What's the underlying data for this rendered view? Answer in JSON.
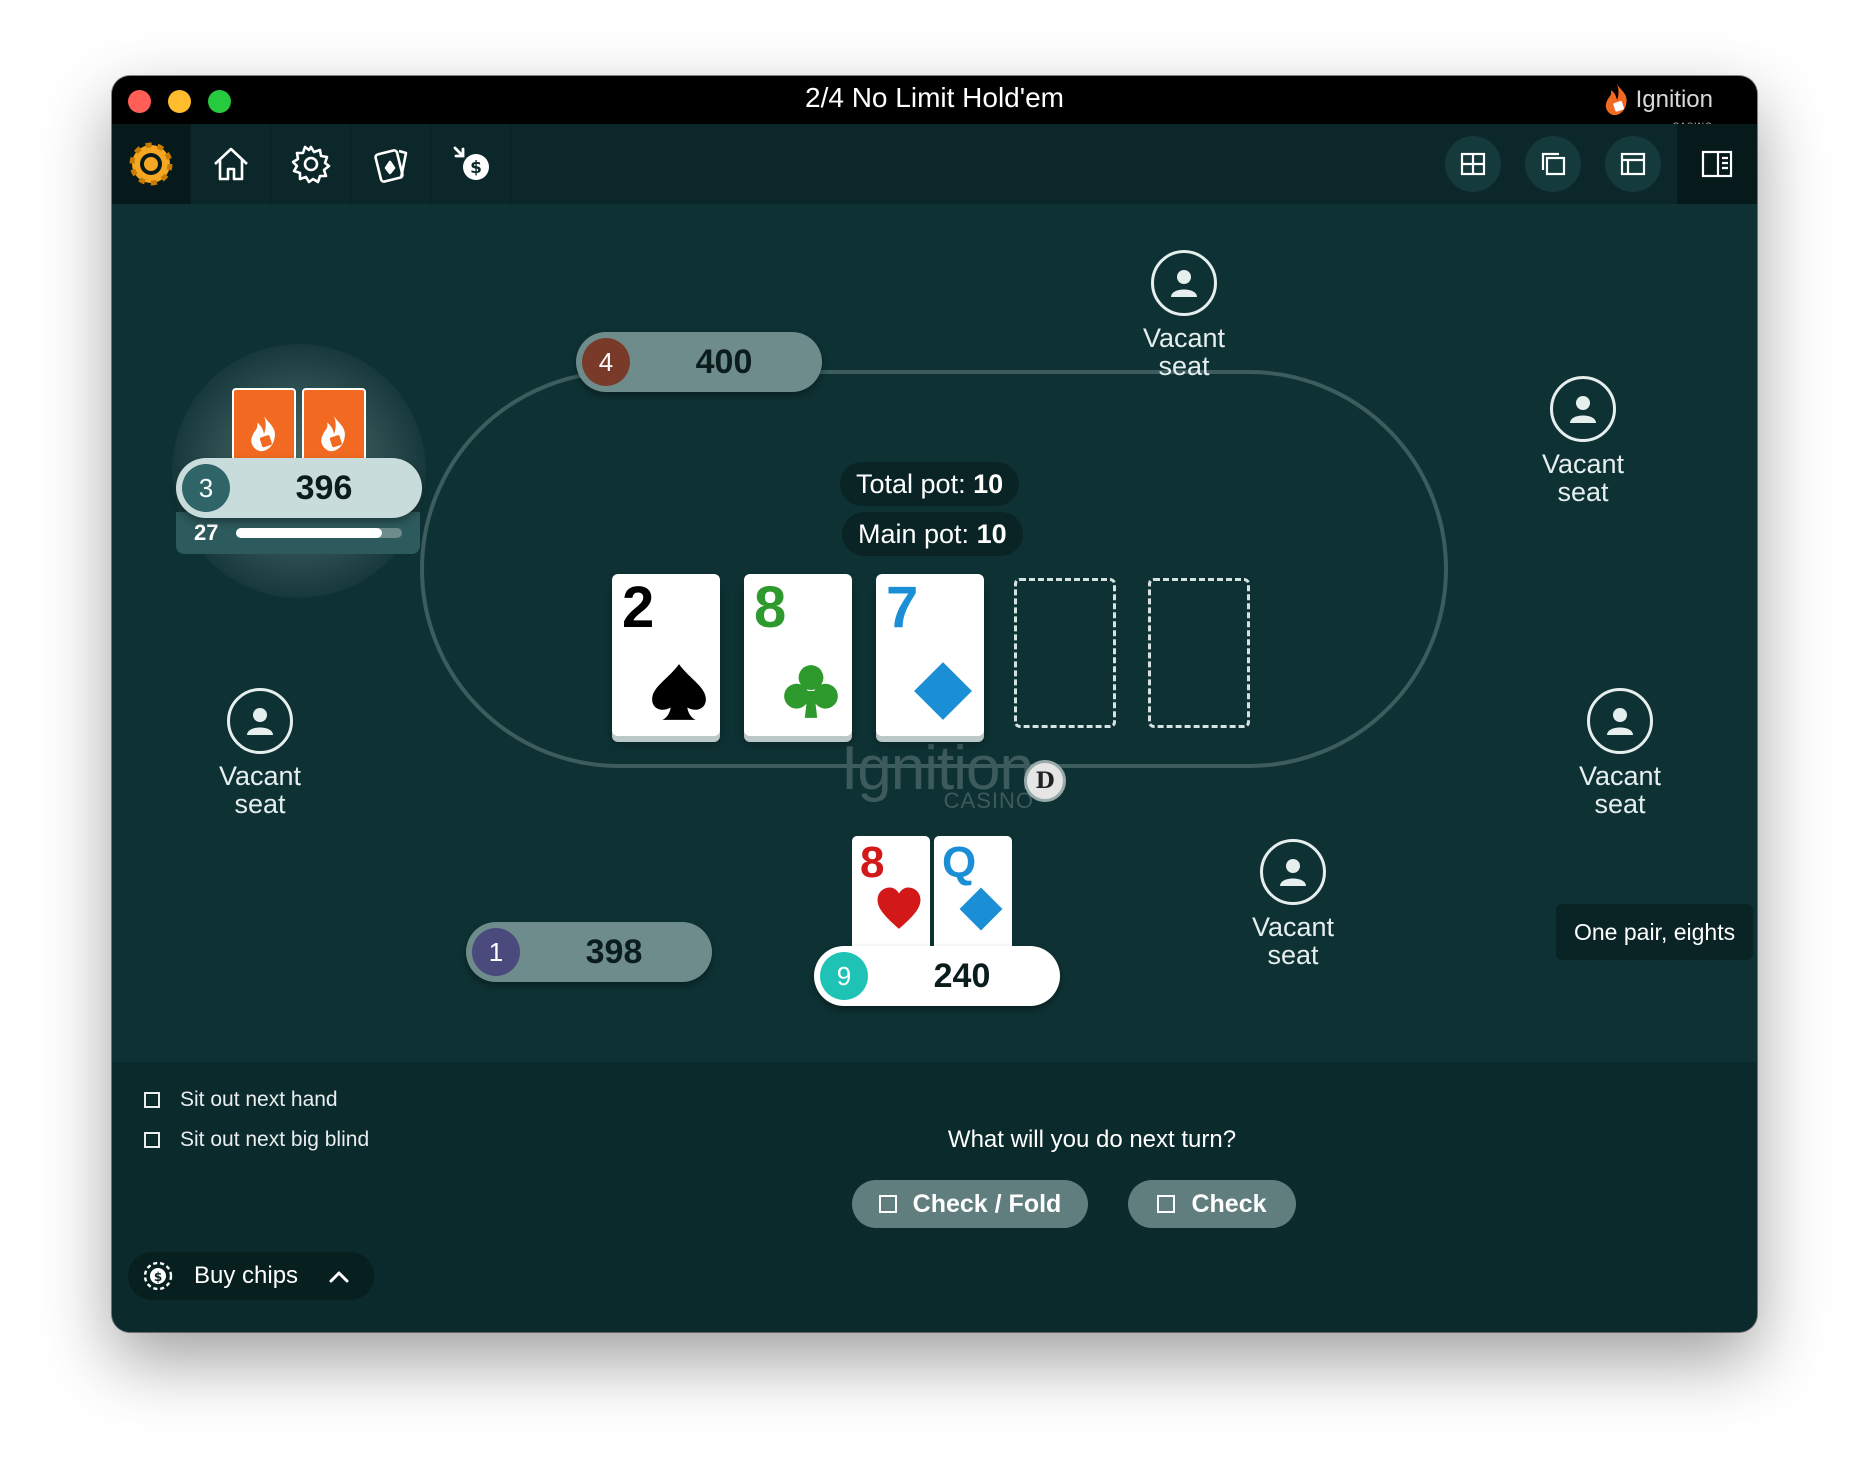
{
  "window": {
    "title": "2/4 No Limit Hold'em",
    "brand": "Ignition",
    "brand_sub": "CASINO"
  },
  "toolbar": {
    "left_icons": [
      "chip-icon",
      "home-icon",
      "gear-icon",
      "cards-icon",
      "cashier-icon"
    ],
    "right_icons": [
      "grid-layout-icon",
      "stacked-windows-icon",
      "window-layout-icon",
      "side-panel-icon"
    ]
  },
  "pot": {
    "total_label": "Total pot:",
    "total_value": "10",
    "main_label": "Main pot:",
    "main_value": "10"
  },
  "board": [
    {
      "rank": "2",
      "suit": "spades",
      "color": "#000000"
    },
    {
      "rank": "8",
      "suit": "clubs",
      "color": "#2e9a2e"
    },
    {
      "rank": "7",
      "suit": "diamonds",
      "color": "#1a8fd6"
    }
  ],
  "table_logo": {
    "word": "Ignition",
    "sub": "CASINO"
  },
  "seats": {
    "seat3": {
      "number": "3",
      "stack": "396",
      "timer": "27",
      "timer_fraction": 0.88,
      "num_color": "#2f6468"
    },
    "seat4": {
      "number": "4",
      "stack": "400",
      "num_color": "#7a3a2a"
    },
    "seat1": {
      "number": "1",
      "stack": "398",
      "num_color": "#4b4a7c"
    },
    "seat9": {
      "number": "9",
      "stack": "240",
      "num_color": "#1fc3b6"
    }
  },
  "hero_cards": [
    {
      "rank": "8",
      "suit": "hearts",
      "color": "#d21818"
    },
    {
      "rank": "Q",
      "suit": "diamonds",
      "color": "#1a8fd6"
    }
  ],
  "dealer_button": "D",
  "vacant_seats": [
    {
      "line1": "Vacant",
      "line2": "seat"
    },
    {
      "line1": "Vacant",
      "line2": "seat"
    },
    {
      "line1": "Vacant",
      "line2": "seat"
    },
    {
      "line1": "Vacant",
      "line2": "seat"
    },
    {
      "line1": "Vacant",
      "line2": "seat"
    }
  ],
  "hand_strength": "One pair, eights",
  "actions": {
    "sit_out_next_hand": "Sit out next hand",
    "sit_out_big_blind": "Sit out next big blind",
    "question": "What will you do next turn?",
    "check_fold": "Check / Fold",
    "check": "Check",
    "buy_chips": "Buy chips"
  }
}
